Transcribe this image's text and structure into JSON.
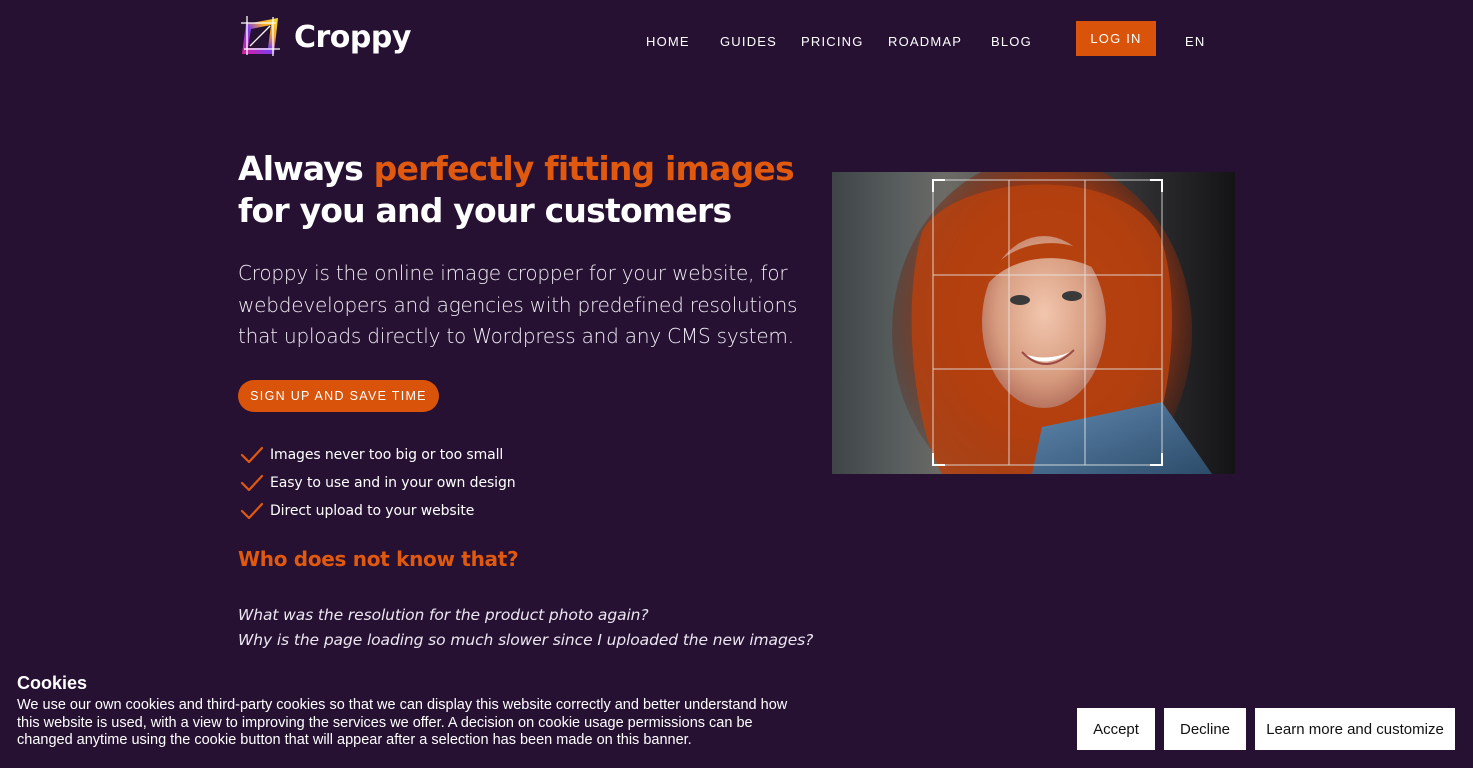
{
  "brand": {
    "name": "Croppy",
    "accent_color": "#d9530a",
    "background_color": "#261133"
  },
  "nav": {
    "items": [
      {
        "label": "HOME"
      },
      {
        "label": "GUIDES"
      },
      {
        "label": "PRICING"
      },
      {
        "label": "ROADMAP"
      },
      {
        "label": "BLOG"
      }
    ],
    "login_label": "LOG IN",
    "language": "EN"
  },
  "hero": {
    "headline_prefix": "Always ",
    "headline_accent": "perfectly fitting images",
    "headline_suffix": "for you and your customers",
    "lead": "Croppy is the online image cropper for your website, for webdevelopers and agencies with predefined resolutions that uploads directly to Wordpress and any CMS system.",
    "cta_label": "SIGN UP AND SAVE TIME",
    "features": [
      {
        "icon": "check-icon",
        "label": "Images never too big or too small"
      },
      {
        "icon": "check-icon",
        "label": "Easy to use and in your own design"
      },
      {
        "icon": "check-icon",
        "label": "Direct upload to your website"
      }
    ],
    "subheading": "Who does not know that?",
    "questions": [
      "What was the resolution for the product photo again?",
      "Why is the page loading so much slower since I uploaded the new images?"
    ]
  },
  "cookie_banner": {
    "title": "Cookies",
    "text": "We use our own cookies and third-party cookies so that we can display this website correctly and better understand how this website is used, with a view to improving the services we offer. A decision on cookie usage permissions can be changed anytime using the cookie button that will appear after a selection has been made on this banner.",
    "accept_label": "Accept",
    "decline_label": "Decline",
    "customize_label": "Learn more and customize"
  }
}
